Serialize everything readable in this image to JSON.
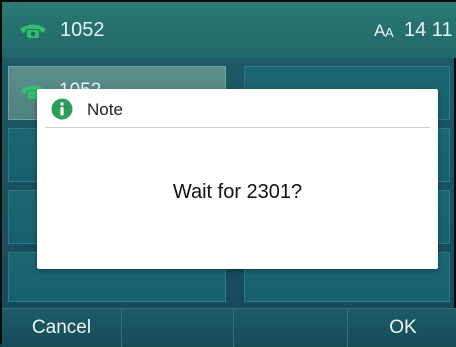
{
  "status_bar": {
    "line_label": "1052",
    "clock": "14 11",
    "icons": [
      "phone-handset-icon",
      "font-size-icon"
    ]
  },
  "tiles": [
    {
      "label": "1052",
      "icon": "phone-handset-icon",
      "active": true
    }
  ],
  "dialog": {
    "title": "Note",
    "icon": "info-icon",
    "message": "Wait for 2301?"
  },
  "softkeys": {
    "left": "Cancel",
    "mid1": "",
    "mid2": "",
    "right": "OK"
  },
  "colors": {
    "accent_green": "#2fc16a",
    "info_green": "#2d9e5a",
    "background_teal": "#1a5360"
  }
}
